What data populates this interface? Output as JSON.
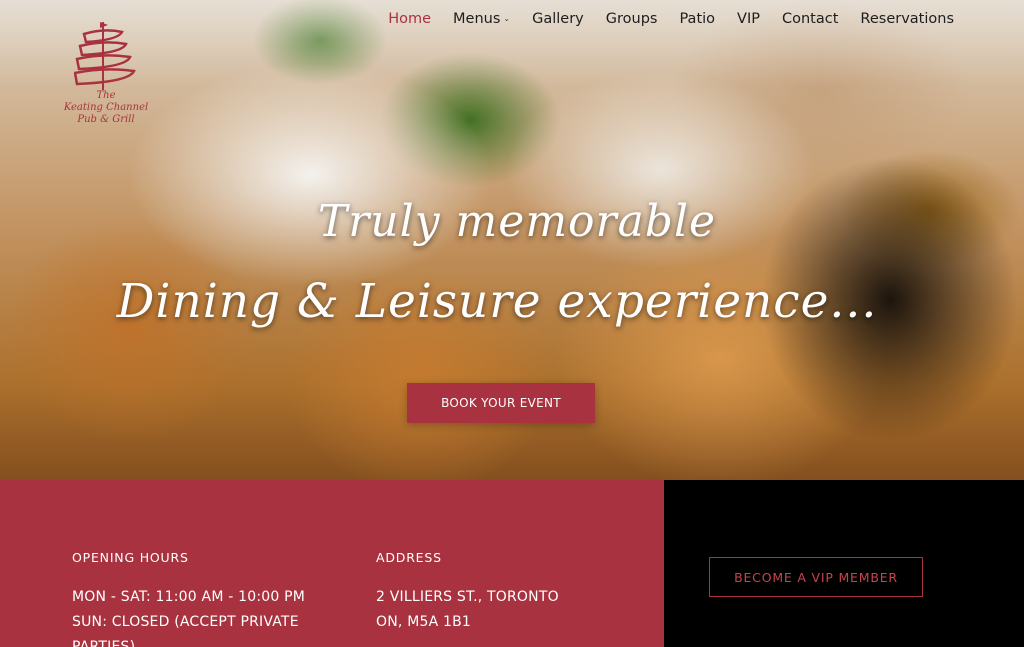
{
  "brand": {
    "logo_lines": [
      "The",
      "Keating Channel",
      "Pub & Grill"
    ],
    "accent_color": "#a8323f"
  },
  "nav": {
    "items": [
      {
        "label": "Home",
        "active": true
      },
      {
        "label": "Menus",
        "has_dropdown": true
      },
      {
        "label": "Gallery"
      },
      {
        "label": "Groups"
      },
      {
        "label": "Patio"
      },
      {
        "label": "VIP"
      },
      {
        "label": "Contact"
      },
      {
        "label": "Reservations"
      }
    ]
  },
  "hero": {
    "headline_line1": "Truly memorable",
    "headline_line2": "Dining & Leisure experience...",
    "cta_label": "BOOK YOUR EVENT"
  },
  "info": {
    "hours_title": "OPENING HOURS",
    "hours_line1": "MON - SAT: 11:00 AM - 10:00 PM",
    "hours_line2": "SUN: CLOSED (ACCEPT PRIVATE PARTIES)",
    "address_title": "ADDRESS",
    "address_line1": "2 VILLIERS ST., TORONTO",
    "address_line2": "ON, M5A 1B1",
    "vip_button": "BECOME A VIP MEMBER"
  }
}
